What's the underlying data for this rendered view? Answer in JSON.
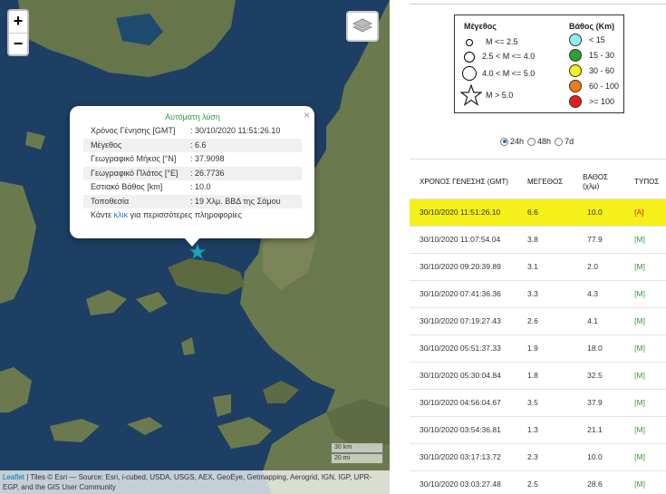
{
  "map": {
    "zoom_in": "+",
    "zoom_out": "−",
    "popup": {
      "title": "Αυτόματη λύση",
      "rows": [
        {
          "key": "Χρόνος Γένησης [GMT]",
          "value": ": 30/10/2020 11:51:26.10"
        },
        {
          "key": "Μέγεθος",
          "value": ": 6.6"
        },
        {
          "key": "Γεωγραφικό Μήκος [°N]",
          "value": ": 37.9098"
        },
        {
          "key": "Γεωγραφικό Πλάτος [°E]",
          "value": ": 26.7736"
        },
        {
          "key": "Εστιακό Βάθος [km]",
          "value": ": 10.0"
        },
        {
          "key": "Τοποθεσία",
          "value": ": 19 Χλμ. ΒΒΔ της Σάμου"
        }
      ],
      "more_prefix": "Κάντε ",
      "more_link": "κλικ",
      "more_suffix": " για περισσότερες πληροφορίες",
      "close": "×"
    },
    "scale_km": "30 km",
    "scale_mi": "20 mi",
    "attribution_link": "Leaflet",
    "attribution_text": " | Tiles © Esri — Source: Esri, i-cubed, USDA, USGS, AEX, GeoEye, Getmapping, Aerogrid, IGN, IGP, UPR-EGP, and the GIS User Community",
    "colors": {
      "sea": "#1d3f63",
      "land": "#6b7a4e",
      "epicenter": "#1ea3b8"
    }
  },
  "legend": {
    "magnitude_title": "Μέγεθος",
    "depth_title": "Βάθος (Km)",
    "magnitude_items": [
      "M <= 2.5",
      "2.5 < M <= 4.0",
      "4.0 < M <= 5.0",
      "M > 5.0"
    ],
    "depth_items": [
      {
        "label": "< 15",
        "color": "#8ff0f5"
      },
      {
        "label": "15 - 30",
        "color": "#2e9e36"
      },
      {
        "label": "30 - 60",
        "color": "#f5f018"
      },
      {
        "label": "60 - 100",
        "color": "#f07a1a"
      },
      {
        "label": ">= 100",
        "color": "#e81c1c"
      }
    ]
  },
  "timeframe": {
    "options": [
      "24h",
      "48h",
      "7d"
    ],
    "selected": "24h"
  },
  "table": {
    "headers": [
      "ΧΡΟΝΟΣ ΓΕΝΕΣΗΣ (GMT)",
      "ΜΕΓΕΘΟΣ",
      "ΒΑΘΟΣ (χλμ)",
      "ΤΥΠΟΣ"
    ],
    "rows": [
      {
        "time": "30/10/2020 11:51:26.10",
        "mag": "6.6",
        "depth": "10.0",
        "type": "[A]"
      },
      {
        "time": "30/10/2020 11:07:54.04",
        "mag": "3.8",
        "depth": "77.9",
        "type": "[M]"
      },
      {
        "time": "30/10/2020 09:20:39.89",
        "mag": "3.1",
        "depth": "2.0",
        "type": "[M]"
      },
      {
        "time": "30/10/2020 07:41:36.36",
        "mag": "3.3",
        "depth": "4.3",
        "type": "[M]"
      },
      {
        "time": "30/10/2020 07:19:27.43",
        "mag": "2.6",
        "depth": "4.1",
        "type": "[M]"
      },
      {
        "time": "30/10/2020 05:51:37.33",
        "mag": "1.9",
        "depth": "18.0",
        "type": "[M]"
      },
      {
        "time": "30/10/2020 05:30:04.84",
        "mag": "1.8",
        "depth": "32.5",
        "type": "[M]"
      },
      {
        "time": "30/10/2020 04:56:04.67",
        "mag": "3.5",
        "depth": "37.9",
        "type": "[M]"
      },
      {
        "time": "30/10/2020 03:54:36.81",
        "mag": "1.3",
        "depth": "21.1",
        "type": "[M]"
      },
      {
        "time": "30/10/2020 03:17:13.72",
        "mag": "2.3",
        "depth": "10.0",
        "type": "[M]"
      },
      {
        "time": "30/10/2020 03:03:27.48",
        "mag": "2.5",
        "depth": "28.6",
        "type": "[M]"
      }
    ],
    "highlight_color": "#f5f019"
  }
}
